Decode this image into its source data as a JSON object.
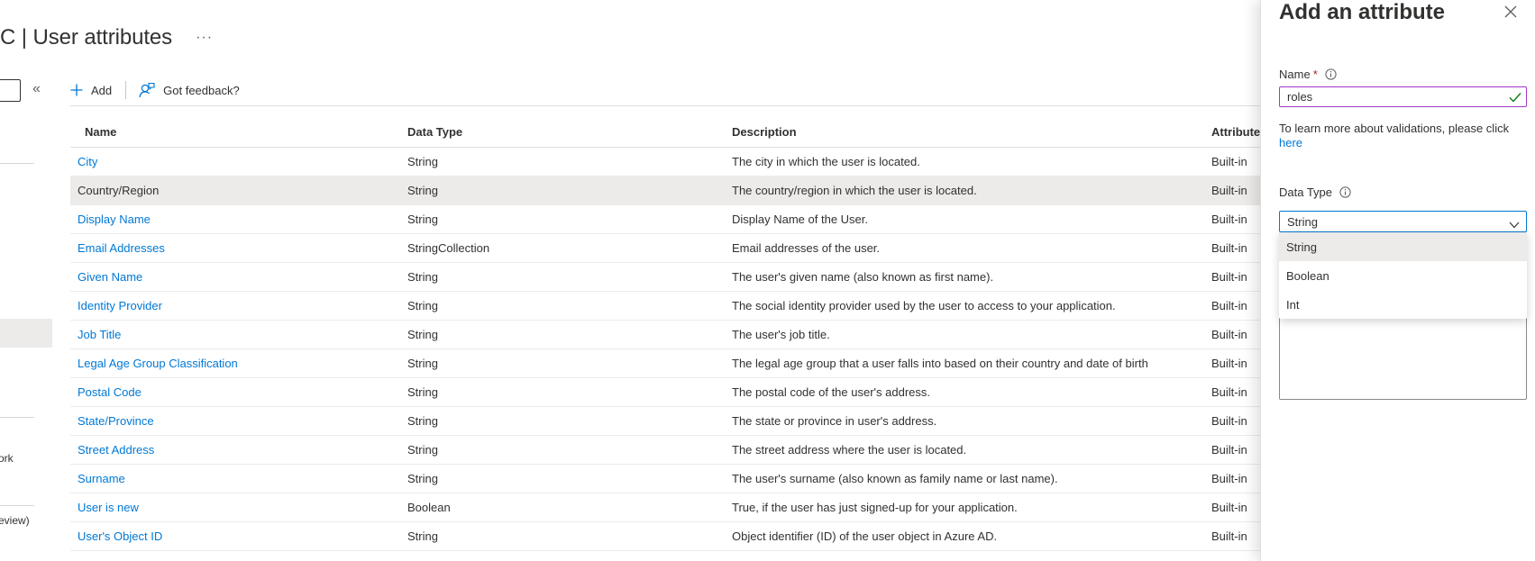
{
  "header": {
    "title": "C | User attributes",
    "more_label": "···"
  },
  "nav": {
    "collapse_label": "«",
    "partial_items": [
      "ork",
      "eview)"
    ]
  },
  "toolbar": {
    "add_label": "Add",
    "feedback_label": "Got feedback?"
  },
  "table": {
    "headers": {
      "name": "Name",
      "type": "Data Type",
      "description": "Description",
      "attribute_type": "Attribute"
    },
    "rows": [
      {
        "name": "City",
        "type": "String",
        "description": "The city in which the user is located.",
        "attribute_type": "Built-in"
      },
      {
        "name": "Country/Region",
        "type": "String",
        "description": "The country/region in which the user is located.",
        "attribute_type": "Built-in",
        "selected": true
      },
      {
        "name": "Display Name",
        "type": "String",
        "description": "Display Name of the User.",
        "attribute_type": "Built-in"
      },
      {
        "name": "Email Addresses",
        "type": "StringCollection",
        "description": "Email addresses of the user.",
        "attribute_type": "Built-in"
      },
      {
        "name": "Given Name",
        "type": "String",
        "description": "The user's given name (also known as first name).",
        "attribute_type": "Built-in"
      },
      {
        "name": "Identity Provider",
        "type": "String",
        "description": "The social identity provider used by the user to access to your application.",
        "attribute_type": "Built-in"
      },
      {
        "name": "Job Title",
        "type": "String",
        "description": "The user's job title.",
        "attribute_type": "Built-in"
      },
      {
        "name": "Legal Age Group Classification",
        "type": "String",
        "description": "The legal age group that a user falls into based on their country and date of birth",
        "attribute_type": "Built-in"
      },
      {
        "name": "Postal Code",
        "type": "String",
        "description": "The postal code of the user's address.",
        "attribute_type": "Built-in"
      },
      {
        "name": "State/Province",
        "type": "String",
        "description": "The state or province in user's address.",
        "attribute_type": "Built-in"
      },
      {
        "name": "Street Address",
        "type": "String",
        "description": "The street address where the user is located.",
        "attribute_type": "Built-in"
      },
      {
        "name": "Surname",
        "type": "String",
        "description": "The user's surname (also known as family name or last name).",
        "attribute_type": "Built-in"
      },
      {
        "name": "User is new",
        "type": "Boolean",
        "description": "True, if the user has just signed-up for your application.",
        "attribute_type": "Built-in"
      },
      {
        "name": "User's Object ID",
        "type": "String",
        "description": "Object identifier (ID) of the user object in Azure AD.",
        "attribute_type": "Built-in"
      }
    ]
  },
  "panel": {
    "title": "Add an attribute",
    "name_label": "Name",
    "required_marker": "*",
    "name_value": "roles",
    "help_text": "To learn more about validations, please click",
    "help_link": "here",
    "data_type_label": "Data Type",
    "data_type_value": "String",
    "data_type_options": [
      "String",
      "Boolean",
      "Int"
    ]
  },
  "colors": {
    "link": "#0078d4",
    "valid_border": "#a238c8",
    "valid_check": "#107c10",
    "focus_border": "#0078d4",
    "required": "#a4262c",
    "selected_row": "#edebe9"
  },
  "icons": {
    "add": "plus-icon",
    "feedback": "feedback-person-icon",
    "close": "close-icon",
    "info": "info-icon",
    "valid": "check-icon",
    "dropdown": "chevron-down-icon",
    "collapse": "double-chevron-left-icon",
    "more": "ellipsis-icon"
  }
}
